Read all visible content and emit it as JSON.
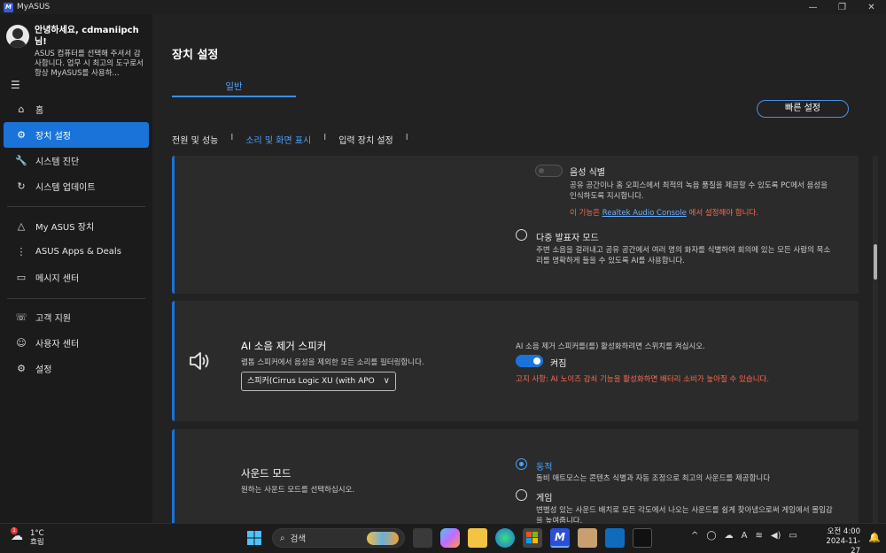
{
  "window": {
    "title": "MyASUS",
    "app_icon_text": "M",
    "minimize": "—",
    "maximize": "❐",
    "close": "✕"
  },
  "sidebar": {
    "greeting": "안녕하세요, cdmaniipch님!",
    "description": "ASUS 컴퓨터를 선택해 주셔서 감사합니다. 업무 시 최고의 도구로서 항상 MyASUS를 사용하...",
    "menu_icon": "☰",
    "group1": [
      {
        "icon": "⌂",
        "label": "홈"
      },
      {
        "icon": "⚙",
        "label": "장치 설정",
        "active": true
      },
      {
        "icon": "🔧",
        "label": "시스템 진단"
      },
      {
        "icon": "↻",
        "label": "시스템 업데이트"
      }
    ],
    "group2": [
      {
        "icon": "△",
        "label": "My ASUS 장치"
      },
      {
        "icon": "⋮",
        "label": "ASUS Apps & Deals"
      },
      {
        "icon": "▭",
        "label": "메시지 센터"
      }
    ],
    "group3": [
      {
        "icon": "☏",
        "label": "고객 지원"
      },
      {
        "icon": "☺",
        "label": "사용자 센터"
      },
      {
        "icon": "⚙",
        "label": "설정"
      }
    ]
  },
  "main": {
    "page_title": "장치 설정",
    "top_tab": "일반",
    "quick_settings": "빠른 설정",
    "subtabs": [
      {
        "label": "전원 및 성능"
      },
      {
        "label": "소리 및 화면 표시",
        "active": true
      },
      {
        "label": "입력 장치 설정"
      }
    ],
    "separator": "I",
    "card1": {
      "voice_id_title": "음성 식별",
      "voice_id_desc": "공유 공간이나 홈 오피스에서 최적의 녹음 품질을 제공할 수 있도록 PC에서 음성을 인식하도록 지시합니다.",
      "warn_prefix": "이 기능은 ",
      "warn_link": "Realtek Audio Console",
      "warn_suffix": " 에서 설정해야 합니다.",
      "multi_title": "다중 발표자 모드",
      "multi_desc": "주변 소음을 걸러내고 공유 공간에서 여러 명의 화자를 식별하여 회의에 있는 모든 사람의 목소리를 명확하게 들을 수 있도록 AI를 사용합니다."
    },
    "card2": {
      "icon": "speaker-icon",
      "title": "AI 소음 제거 스피커",
      "subtitle": "랩톱 스피커에서 음성을 제외한 모든 소리를 필터링합니다.",
      "select_value": "스피커(Cirrus Logic XU (with APO",
      "chevron": "∨",
      "hint": "AI 소음 제거 스피커를(를) 활성화하려면 스위치를 켜십시오.",
      "toggle_label": "켜짐",
      "toggle_on": true,
      "warning": "고지 사항: AI 노이즈 감쇠 기능을 활성화하면 배터리 소비가 높아질 수 있습니다."
    },
    "card3": {
      "title": "사운드 모드",
      "subtitle": "원하는 사운드 모드를 선택하십시오.",
      "options": [
        {
          "label": "동적",
          "desc": "돌비 애트모스는 콘텐츠 식별과 자동 조정으로 최고의 사운드를 제공합니다",
          "selected": true
        },
        {
          "label": "게임",
          "desc": "변별성 있는 사운드 배치로 모든 각도에서 나오는 사운드를 쉽게 찾아냄으로써 게임에서 몰입감을 높여줍니다.",
          "selected": false
        }
      ]
    }
  },
  "taskbar": {
    "weather_badge": "1",
    "temp": "1°C",
    "condition": "흐림",
    "search_placeholder": "검색",
    "search_icon": "⌕",
    "tray_chevron": "^",
    "tray_lang": "A",
    "time": "오전 4:00",
    "date": "2024-11-27"
  },
  "colors": {
    "accent": "#1a73d8",
    "accent_text": "#4aa3ff",
    "warning": "#ff6a4d"
  }
}
